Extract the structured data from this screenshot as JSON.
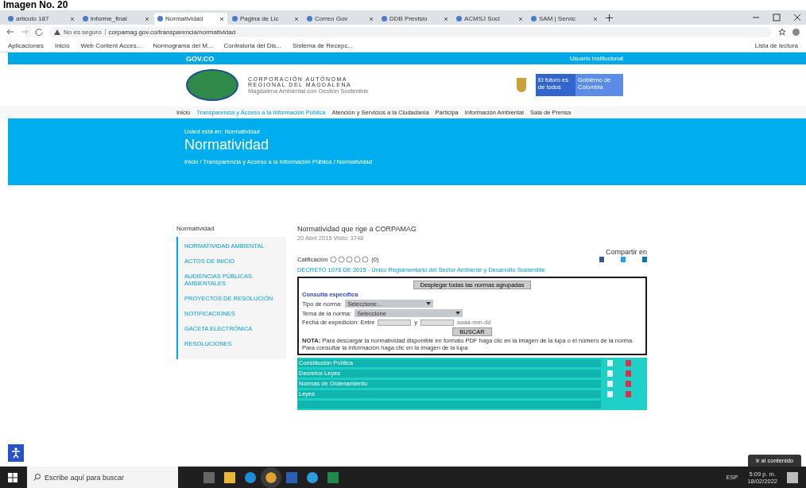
{
  "caption": "Imagen No. 20",
  "browser": {
    "tabs": [
      {
        "label": "articulo 187",
        "selected": false
      },
      {
        "label": "informe_final",
        "selected": false
      },
      {
        "label": "Normatividad",
        "selected": true
      },
      {
        "label": "Pagina de Lic",
        "selected": false
      },
      {
        "label": "Correo Gov",
        "selected": false
      },
      {
        "label": "DDB Previsio",
        "selected": false
      },
      {
        "label": "ACMSJ Soci",
        "selected": false
      },
      {
        "label": "SAM | Servic",
        "selected": false
      }
    ],
    "security": "No es seguro",
    "url": "corpamag.gov.co/transparencia/normatividad",
    "bookmarks": [
      "Aplicaciones",
      "Inicio",
      "Web Content Acces...",
      "Normograma del M...",
      "Contraloria del Dis...",
      "Sistema de Recepc..."
    ],
    "reading_list": "Lista de lectura"
  },
  "govbar": {
    "brand": "GOV.CO",
    "user": "Usuario institucional"
  },
  "header": {
    "org_lines": [
      "CORPORACIÓN AUTÓNOMA",
      "REGIONAL DEL MAGDALENA"
    ],
    "slogan": "Magdalena Ambiental con Gestión Sostenible",
    "badge_left": "El futuro es de todos",
    "badge_right": "Gobierno de Colombia"
  },
  "nav": [
    "Inicio",
    "Transparencia y Acceso a la Información Pública",
    "Atención y Servicios a la Ciudadanía",
    "Participa",
    "Información Ambiental",
    "Sala de Prensa"
  ],
  "banner": {
    "pretitle": "Usted está en: Normatividad",
    "title": "Normatividad",
    "breadcrumb": "Inicio / Transparencia y Acceso a la Información Pública / Normatividad"
  },
  "sidebar": {
    "title": "Normatividad",
    "items": [
      "NORMATIVIDAD AMBIENTAL",
      "ACTOS DE INICIO",
      "AUDIENCIAS PÚBLICAS AMBIENTALES",
      "PROYECTOS DE RESOLUCIÓN",
      "NOTIFICACIONES",
      "GACETA ELECTRÓNICA",
      "RESOLUCIONES"
    ]
  },
  "main": {
    "title": "Normatividad que rige a CORPAMAG",
    "meta": "20 Abril 2015 Visto: 3748",
    "share_label": "Compartir en",
    "rating": {
      "label": "Calificación",
      "stars": 0,
      "count": "(0)"
    },
    "decree_link": "DECRETO 1076 DE 2015 - Único Reglamentario del Sector Ambiente y Desarrollo Sostenible",
    "search_box": {
      "expand_button": "Desplegar todas las normas agrupadas",
      "heading": "Consulta específica",
      "type_label": "Tipo de norma:",
      "type_value": "Seleccione...",
      "topic_label": "Tema de la norma:",
      "topic_value": "Seleccione",
      "date_label": "Fecha de expedición: Entre",
      "date_and": "y",
      "date_hint": "aaaa-mm-dd",
      "search_button": "BUSCAR",
      "note": "**NOTA:** Para descargar la normatividad disponible en formato PDF haga clic en la imagen de la lupa o el número de la norma. Para consultar la información haga clic en la imagen de la lupa"
    },
    "groups": [
      "Constitución Política",
      "Decretos Leyes",
      "Normas de Ordenamiento",
      "Leyes"
    ]
  },
  "skip_link": "Ir al contenido",
  "taskbar": {
    "search_placeholder": "Escribe aquí para buscar",
    "language": "ESP",
    "time": "5:09 p. m.",
    "date": "18/02/2022"
  }
}
